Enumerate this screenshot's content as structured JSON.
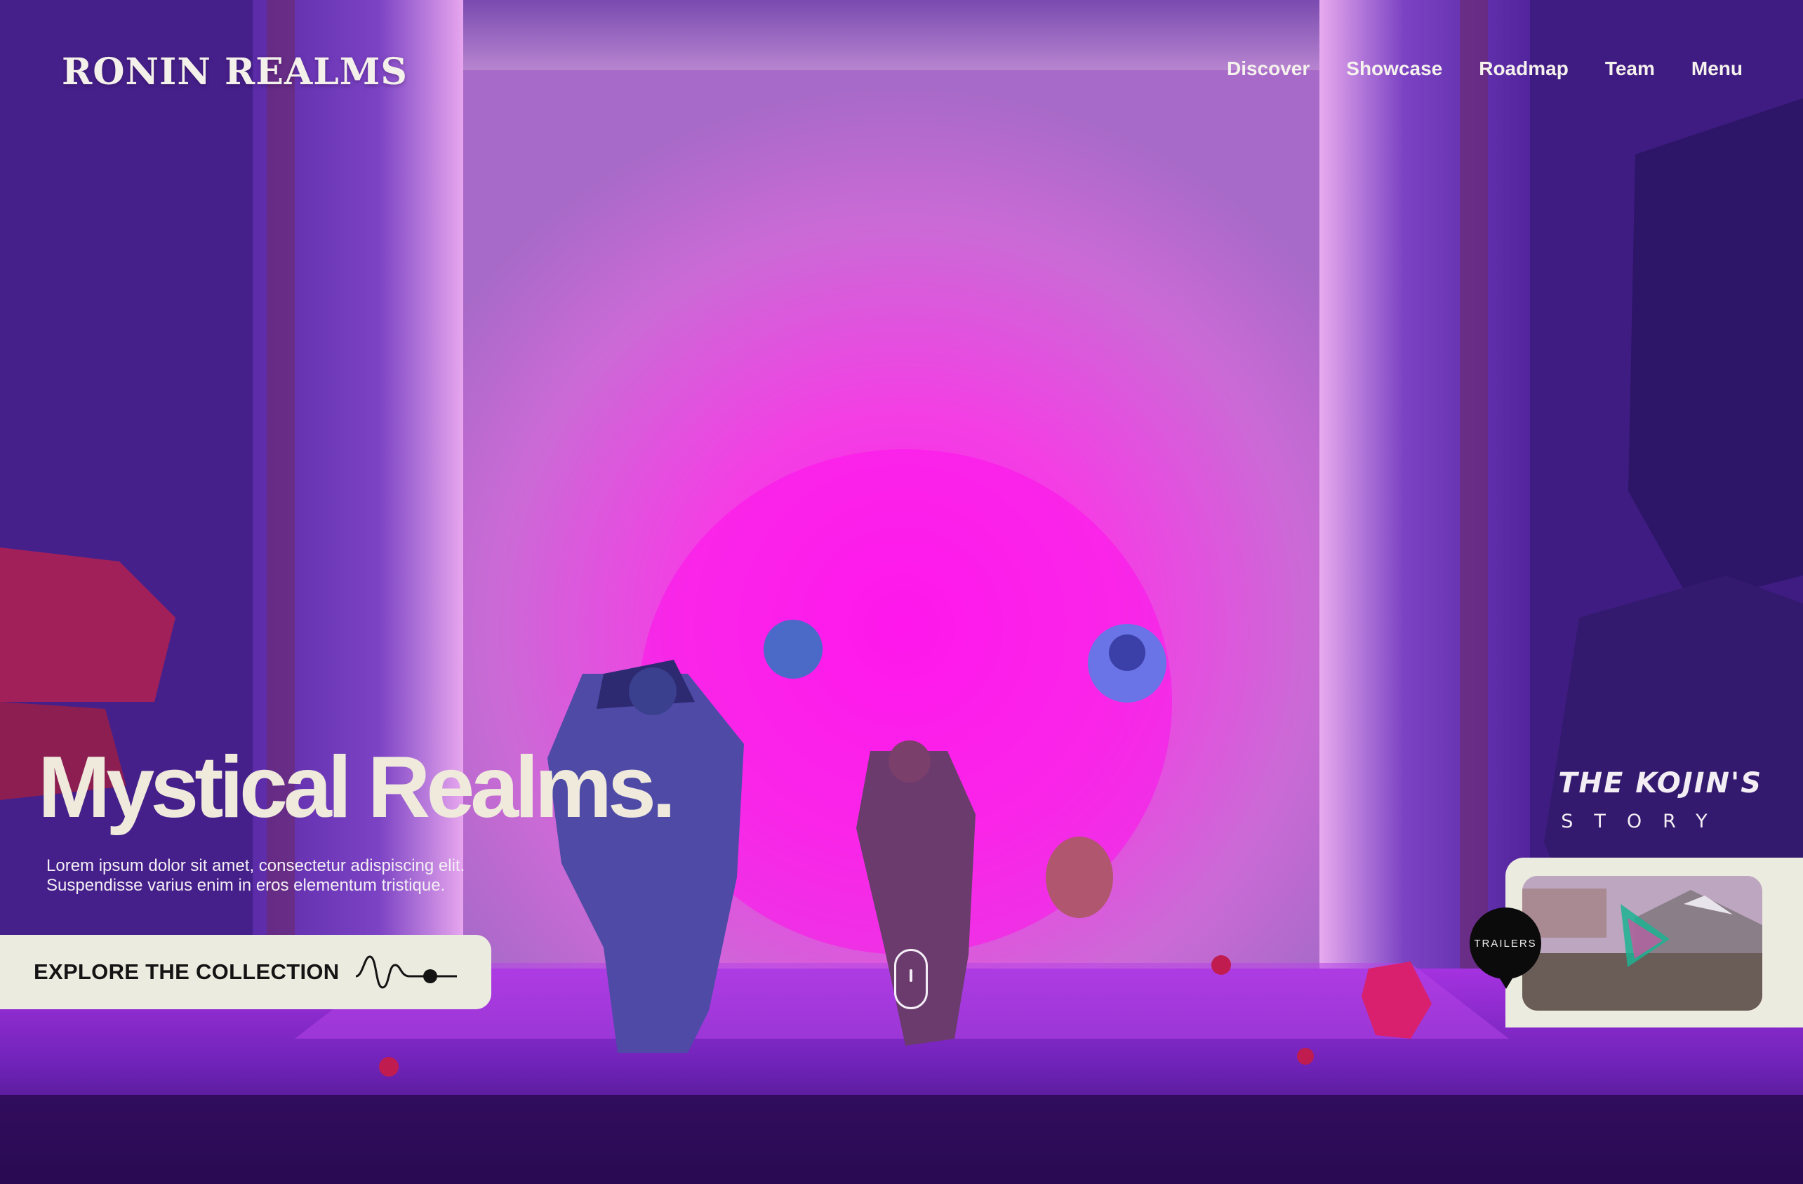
{
  "brand": {
    "logo_text": "RONIN REALMS"
  },
  "nav": {
    "items": [
      {
        "label": "Discover"
      },
      {
        "label": "Showcase"
      },
      {
        "label": "Roadmap"
      },
      {
        "label": "Team"
      },
      {
        "label": "Menu"
      }
    ]
  },
  "hero": {
    "title": "Mystical Realms.",
    "subtitle_line1": "Lorem ipsum dolor sit amet, consectetur adispiscing elit.",
    "subtitle_line2": "Suspendisse varius enim in eros elementum tristique.",
    "cta_label": "EXPLORE THE COLLECTION"
  },
  "story": {
    "title": "THE KOJIN'S",
    "subtitle": "STORY"
  },
  "trailer": {
    "badge_label": "TRAILERS"
  },
  "colors": {
    "accent_magenta": "#ff1fe6",
    "deep_purple": "#2a0a52",
    "cream": "#ecebe0"
  }
}
